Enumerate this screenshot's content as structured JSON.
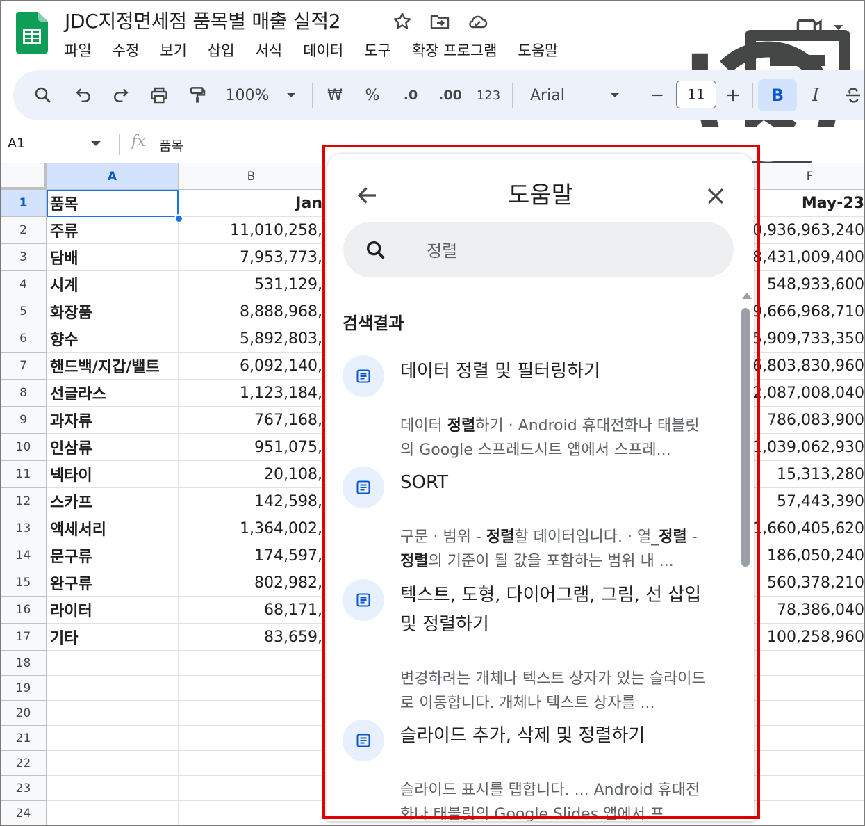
{
  "header": {
    "doc_title": "JDC지정면세점 품목별 매출 실적2",
    "menu": [
      "파일",
      "수정",
      "보기",
      "삽입",
      "서식",
      "데이터",
      "도구",
      "확장 프로그램",
      "도움말"
    ],
    "title_icons": [
      "star-icon",
      "move-folder-icon",
      "cloud-status-icon"
    ],
    "right_icons": [
      "version-history-icon",
      "comments-icon",
      "meet-video-icon"
    ]
  },
  "toolbar": {
    "zoom": "100%",
    "currency": "₩",
    "percent": "%",
    "decrease_decimal": ".0",
    "increase_decimal": ".00",
    "number_format": "123",
    "font": "Arial",
    "font_size": "11",
    "bold": "B",
    "italic": "I"
  },
  "formula_bar": {
    "cell_ref": "A1",
    "fx": "fx",
    "value": "품목"
  },
  "grid": {
    "col_headers": [
      "A",
      "B",
      "F"
    ],
    "header_row": [
      "품목",
      "Jan",
      "May-23"
    ],
    "rows": [
      {
        "num": "2",
        "a": "주류",
        "b": "11,010,258,",
        "f": "0,936,963,240"
      },
      {
        "num": "3",
        "a": "담배",
        "b": "7,953,773,",
        "f": "8,431,009,400"
      },
      {
        "num": "4",
        "a": "시계",
        "b": "531,129,",
        "f": "548,933,600"
      },
      {
        "num": "5",
        "a": "화장품",
        "b": "8,888,968,",
        "f": "9,666,968,710"
      },
      {
        "num": "6",
        "a": "향수",
        "b": "5,892,803,",
        "f": "5,909,733,350"
      },
      {
        "num": "7",
        "a": "핸드백/지갑/밸트",
        "b": "6,092,140,",
        "f": "6,803,830,960"
      },
      {
        "num": "8",
        "a": "선글라스",
        "b": "1,123,184,",
        "f": "2,087,008,040"
      },
      {
        "num": "9",
        "a": "과자류",
        "b": "767,168,",
        "f": "786,083,900"
      },
      {
        "num": "10",
        "a": "인삼류",
        "b": "951,075,",
        "f": "1,039,062,930"
      },
      {
        "num": "11",
        "a": "넥타이",
        "b": "20,108,",
        "f": "15,313,280"
      },
      {
        "num": "12",
        "a": "스카프",
        "b": "142,598,",
        "f": "57,443,390"
      },
      {
        "num": "13",
        "a": "액세서리",
        "b": "1,364,002,",
        "f": "1,660,405,620"
      },
      {
        "num": "14",
        "a": "문구류",
        "b": "174,597,",
        "f": "186,050,240"
      },
      {
        "num": "15",
        "a": "완구류",
        "b": "802,982,",
        "f": "560,378,210"
      },
      {
        "num": "16",
        "a": "라이터",
        "b": "68,171,",
        "f": "78,386,040"
      },
      {
        "num": "17",
        "a": "기타",
        "b": "83,659,",
        "f": "100,258,960"
      }
    ],
    "empty_rows": [
      "18",
      "19",
      "20",
      "21",
      "22",
      "23",
      "24"
    ]
  },
  "help": {
    "title": "도움말",
    "search_value": "정렬",
    "results_heading": "검색결과",
    "results": [
      {
        "title": "데이터 정렬 및 필터링하기",
        "snippet_html": "데이터 <b>정렬</b>하기 · Android 휴대전화나 태블릿의 Google 스프레드시트 앱에서 스프레..."
      },
      {
        "title": "SORT",
        "snippet_html": "구문 · 범위 - <b>정렬</b>할 데이터입니다. · 열_<b>정렬</b> - <b>정렬</b>의 기준이 될 값을 포함하는 범위 내 ..."
      },
      {
        "title": "텍스트, 도형, 다이어그램, 그림, 선 삽입 및 정렬하기",
        "snippet_html": "변경하려는 개체나 텍스트 상자가 있는 슬라이드로 이동합니다. 개체나 텍스트 상자를 ..."
      },
      {
        "title": "슬라이드 추가, 삭제 및 정렬하기",
        "snippet_html": "슬라이드 표시를 탭합니다. ... Android 휴대전화나 태블릿의 Google Slides 앱에서 프..."
      }
    ]
  },
  "colors": {
    "accent": "#1a73e8",
    "highlight_frame": "#e00000",
    "sheets_green": "#0f9d58",
    "toolbar_bg": "#edf2fa"
  }
}
